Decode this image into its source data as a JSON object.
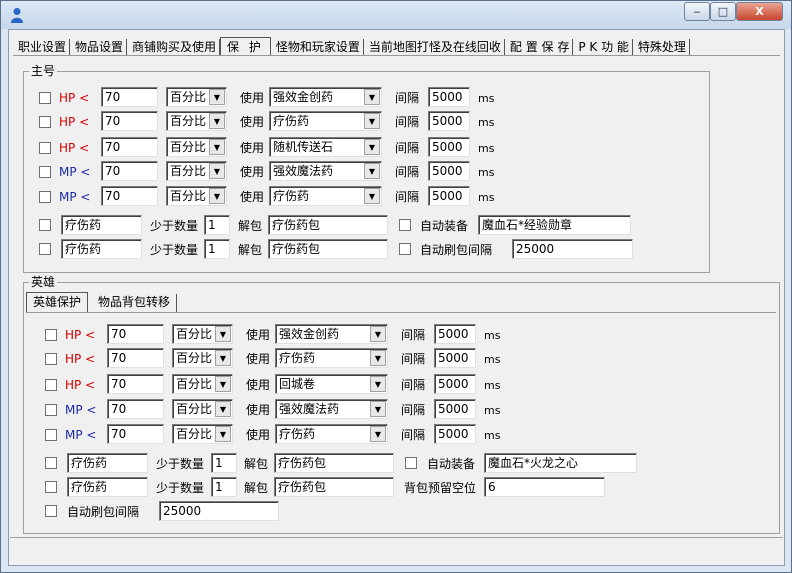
{
  "window": {
    "minimize_label": "‒",
    "maximize_label": "□",
    "close_label": "X"
  },
  "tabs": [
    {
      "label": "职业设置"
    },
    {
      "label": "物品设置"
    },
    {
      "label": "商铺购买及使用"
    },
    {
      "label": "保 护"
    },
    {
      "label": "怪物和玩家设置"
    },
    {
      "label": "当前地图打怪及在线回收"
    },
    {
      "label": "配 置  保 存"
    },
    {
      "label": "P K 功 能"
    },
    {
      "label": "特殊处理"
    }
  ],
  "main": {
    "title": "主号",
    "rows": [
      {
        "stat": "HP <",
        "value": "70",
        "mode": "百分比",
        "use": "使用",
        "item": "强效金创药",
        "interval_label": "间隔",
        "interval": "5000",
        "unit": "ms"
      },
      {
        "stat": "HP <",
        "value": "70",
        "mode": "百分比",
        "use": "使用",
        "item": "疗伤药",
        "interval_label": "间隔",
        "interval": "5000",
        "unit": "ms"
      },
      {
        "stat": "HP <",
        "value": "70",
        "mode": "百分比",
        "use": "使用",
        "item": "随机传送石",
        "interval_label": "间隔",
        "interval": "5000",
        "unit": "ms"
      },
      {
        "stat": "MP <",
        "value": "70",
        "mode": "百分比",
        "use": "使用",
        "item": "强效魔法药",
        "interval_label": "间隔",
        "interval": "5000",
        "unit": "ms"
      },
      {
        "stat": "MP <",
        "value": "70",
        "mode": "百分比",
        "use": "使用",
        "item": "疗伤药",
        "interval_label": "间隔",
        "interval": "5000",
        "unit": "ms"
      }
    ],
    "bundle1": {
      "item": "疗伤药",
      "less_label": "少于数量",
      "count": "1",
      "unpack_label": "解包",
      "pack": "疗伤药包",
      "equip_label": "自动装备",
      "equip": "魔血石*经验勋章"
    },
    "bundle2": {
      "item": "疗伤药",
      "less_label": "少于数量",
      "count": "1",
      "unpack_label": "解包",
      "pack": "疗伤药包",
      "refresh_label": "自动刷包间隔",
      "refresh": "25000"
    }
  },
  "hero": {
    "title": "英雄",
    "subtabs": [
      {
        "label": "英雄保护"
      },
      {
        "label": "物品背包转移"
      }
    ],
    "rows": [
      {
        "stat": "HP <",
        "value": "70",
        "mode": "百分比",
        "use": "使用",
        "item": "强效金创药",
        "interval_label": "间隔",
        "interval": "5000",
        "unit": "ms"
      },
      {
        "stat": "HP <",
        "value": "70",
        "mode": "百分比",
        "use": "使用",
        "item": "疗伤药",
        "interval_label": "间隔",
        "interval": "5000",
        "unit": "ms"
      },
      {
        "stat": "HP <",
        "value": "70",
        "mode": "百分比",
        "use": "使用",
        "item": "回城卷",
        "interval_label": "间隔",
        "interval": "5000",
        "unit": "ms"
      },
      {
        "stat": "MP <",
        "value": "70",
        "mode": "百分比",
        "use": "使用",
        "item": "强效魔法药",
        "interval_label": "间隔",
        "interval": "5000",
        "unit": "ms"
      },
      {
        "stat": "MP <",
        "value": "70",
        "mode": "百分比",
        "use": "使用",
        "item": "疗伤药",
        "interval_label": "间隔",
        "interval": "5000",
        "unit": "ms"
      }
    ],
    "bundle1": {
      "item": "疗伤药",
      "less_label": "少于数量",
      "count": "1",
      "unpack_label": "解包",
      "pack": "疗伤药包",
      "equip_label": "自动装备",
      "equip": "魔血石*火龙之心"
    },
    "bundle2": {
      "item": "疗伤药",
      "less_label": "少于数量",
      "count": "1",
      "unpack_label": "解包",
      "pack": "疗伤药包",
      "reserve_label": "背包预留空位",
      "reserve": "6"
    },
    "refresh_label": "自动刷包间隔",
    "refresh": "25000"
  }
}
